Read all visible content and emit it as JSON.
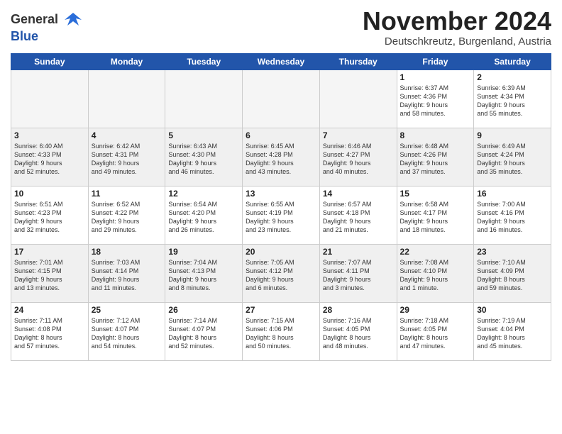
{
  "header": {
    "logo_line1": "General",
    "logo_line2": "Blue",
    "month": "November 2024",
    "location": "Deutschkreutz, Burgenland, Austria"
  },
  "days_of_week": [
    "Sunday",
    "Monday",
    "Tuesday",
    "Wednesday",
    "Thursday",
    "Friday",
    "Saturday"
  ],
  "weeks": [
    [
      {
        "day": "",
        "empty": true
      },
      {
        "day": "",
        "empty": true
      },
      {
        "day": "",
        "empty": true
      },
      {
        "day": "",
        "empty": true
      },
      {
        "day": "",
        "empty": true
      },
      {
        "day": "1",
        "text": "Sunrise: 6:37 AM\nSunset: 4:36 PM\nDaylight: 9 hours\nand 58 minutes."
      },
      {
        "day": "2",
        "text": "Sunrise: 6:39 AM\nSunset: 4:34 PM\nDaylight: 9 hours\nand 55 minutes."
      }
    ],
    [
      {
        "day": "3",
        "text": "Sunrise: 6:40 AM\nSunset: 4:33 PM\nDaylight: 9 hours\nand 52 minutes."
      },
      {
        "day": "4",
        "text": "Sunrise: 6:42 AM\nSunset: 4:31 PM\nDaylight: 9 hours\nand 49 minutes."
      },
      {
        "day": "5",
        "text": "Sunrise: 6:43 AM\nSunset: 4:30 PM\nDaylight: 9 hours\nand 46 minutes."
      },
      {
        "day": "6",
        "text": "Sunrise: 6:45 AM\nSunset: 4:28 PM\nDaylight: 9 hours\nand 43 minutes."
      },
      {
        "day": "7",
        "text": "Sunrise: 6:46 AM\nSunset: 4:27 PM\nDaylight: 9 hours\nand 40 minutes."
      },
      {
        "day": "8",
        "text": "Sunrise: 6:48 AM\nSunset: 4:26 PM\nDaylight: 9 hours\nand 37 minutes."
      },
      {
        "day": "9",
        "text": "Sunrise: 6:49 AM\nSunset: 4:24 PM\nDaylight: 9 hours\nand 35 minutes."
      }
    ],
    [
      {
        "day": "10",
        "text": "Sunrise: 6:51 AM\nSunset: 4:23 PM\nDaylight: 9 hours\nand 32 minutes."
      },
      {
        "day": "11",
        "text": "Sunrise: 6:52 AM\nSunset: 4:22 PM\nDaylight: 9 hours\nand 29 minutes."
      },
      {
        "day": "12",
        "text": "Sunrise: 6:54 AM\nSunset: 4:20 PM\nDaylight: 9 hours\nand 26 minutes."
      },
      {
        "day": "13",
        "text": "Sunrise: 6:55 AM\nSunset: 4:19 PM\nDaylight: 9 hours\nand 23 minutes."
      },
      {
        "day": "14",
        "text": "Sunrise: 6:57 AM\nSunset: 4:18 PM\nDaylight: 9 hours\nand 21 minutes."
      },
      {
        "day": "15",
        "text": "Sunrise: 6:58 AM\nSunset: 4:17 PM\nDaylight: 9 hours\nand 18 minutes."
      },
      {
        "day": "16",
        "text": "Sunrise: 7:00 AM\nSunset: 4:16 PM\nDaylight: 9 hours\nand 16 minutes."
      }
    ],
    [
      {
        "day": "17",
        "text": "Sunrise: 7:01 AM\nSunset: 4:15 PM\nDaylight: 9 hours\nand 13 minutes."
      },
      {
        "day": "18",
        "text": "Sunrise: 7:03 AM\nSunset: 4:14 PM\nDaylight: 9 hours\nand 11 minutes."
      },
      {
        "day": "19",
        "text": "Sunrise: 7:04 AM\nSunset: 4:13 PM\nDaylight: 9 hours\nand 8 minutes."
      },
      {
        "day": "20",
        "text": "Sunrise: 7:05 AM\nSunset: 4:12 PM\nDaylight: 9 hours\nand 6 minutes."
      },
      {
        "day": "21",
        "text": "Sunrise: 7:07 AM\nSunset: 4:11 PM\nDaylight: 9 hours\nand 3 minutes."
      },
      {
        "day": "22",
        "text": "Sunrise: 7:08 AM\nSunset: 4:10 PM\nDaylight: 9 hours\nand 1 minute."
      },
      {
        "day": "23",
        "text": "Sunrise: 7:10 AM\nSunset: 4:09 PM\nDaylight: 8 hours\nand 59 minutes."
      }
    ],
    [
      {
        "day": "24",
        "text": "Sunrise: 7:11 AM\nSunset: 4:08 PM\nDaylight: 8 hours\nand 57 minutes."
      },
      {
        "day": "25",
        "text": "Sunrise: 7:12 AM\nSunset: 4:07 PM\nDaylight: 8 hours\nand 54 minutes."
      },
      {
        "day": "26",
        "text": "Sunrise: 7:14 AM\nSunset: 4:07 PM\nDaylight: 8 hours\nand 52 minutes."
      },
      {
        "day": "27",
        "text": "Sunrise: 7:15 AM\nSunset: 4:06 PM\nDaylight: 8 hours\nand 50 minutes."
      },
      {
        "day": "28",
        "text": "Sunrise: 7:16 AM\nSunset: 4:05 PM\nDaylight: 8 hours\nand 48 minutes."
      },
      {
        "day": "29",
        "text": "Sunrise: 7:18 AM\nSunset: 4:05 PM\nDaylight: 8 hours\nand 47 minutes."
      },
      {
        "day": "30",
        "text": "Sunrise: 7:19 AM\nSunset: 4:04 PM\nDaylight: 8 hours\nand 45 minutes."
      }
    ]
  ]
}
